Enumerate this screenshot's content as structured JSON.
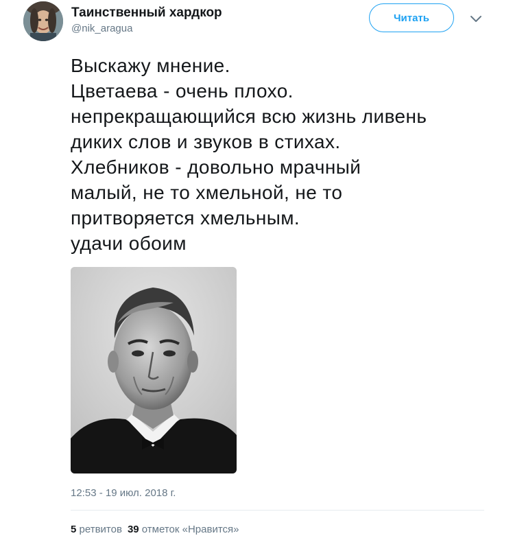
{
  "author": {
    "display_name": "Таинственный хардкор",
    "handle": "@nik_aragua"
  },
  "follow_button": {
    "label": "Читать"
  },
  "icons": {
    "menu": "chevron-down-icon"
  },
  "tweet": {
    "lines": [
      "Выскажу мнение.",
      "Цветаева - очень плохо.",
      "непрекращающийся всю жизнь ливень",
      "диких слов и звуков в стихах.",
      "Хлебников - довольно мрачный",
      "малый, не то хмельной, не то",
      "притворяется хмельным.",
      "удачи обоим"
    ],
    "timestamp": "12:53 - 19 июл. 2018 г."
  },
  "stats": {
    "retweets_count": "5",
    "retweets_label": "ретвитов",
    "likes_count": "39",
    "likes_label": "отметок «Нравится»"
  },
  "colors": {
    "accent": "#1da1f2",
    "text": "#14171a",
    "secondary": "#657786",
    "divider": "#e6ecf0"
  }
}
